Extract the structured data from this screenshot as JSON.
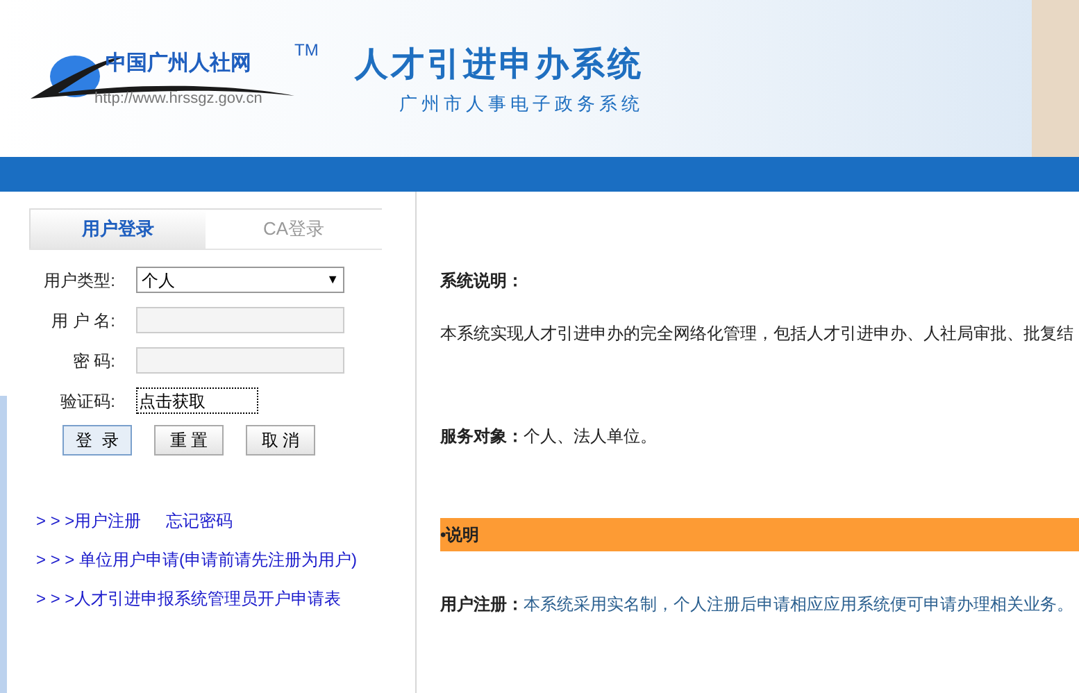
{
  "header": {
    "logo_text": "中国广州人社网",
    "trademark": "TM",
    "logo_url": "http://www.hrssgz.gov.cn",
    "title": "人才引进申办系统",
    "subtitle": "广州市人事电子政务系统"
  },
  "login": {
    "tabs": [
      {
        "label": "用户登录",
        "selected": true
      },
      {
        "label": "CA登录",
        "selected": false
      }
    ],
    "fields": [
      {
        "kind": "select",
        "label": "用户类型:",
        "value": "个人",
        "caret": "▼"
      },
      {
        "kind": "input",
        "label": "用 户 名:"
      },
      {
        "kind": "input",
        "label": "密 码:"
      },
      {
        "kind": "captcha",
        "label": "验证码:",
        "value": "点击获取"
      }
    ],
    "buttons": [
      {
        "label": "登  录",
        "focused": true
      },
      {
        "label": "重 置",
        "focused": false
      },
      {
        "label": "取 消",
        "focused": false
      }
    ],
    "links": [
      [
        "> > >用户注册",
        "忘记密码"
      ],
      [
        "> > > 单位用户申请(申请前请先注册为用户)"
      ],
      [
        "> > >人才引进申报系统管理员开户申请表"
      ]
    ]
  },
  "content": {
    "intro_heading": "系统说明：",
    "intro_text": "本系统实现人才引进申办的完全网络化管理，包括人才引进申办、人社局审批、批复结",
    "audience_label": "服务对象：",
    "audience_text": "个人、法人单位。",
    "section_bar": "•说明",
    "register_label": "用户注册：",
    "register_text": "本系统采用实名制，个人注册后申请相应应用系统便可申请办理相关业务。"
  }
}
